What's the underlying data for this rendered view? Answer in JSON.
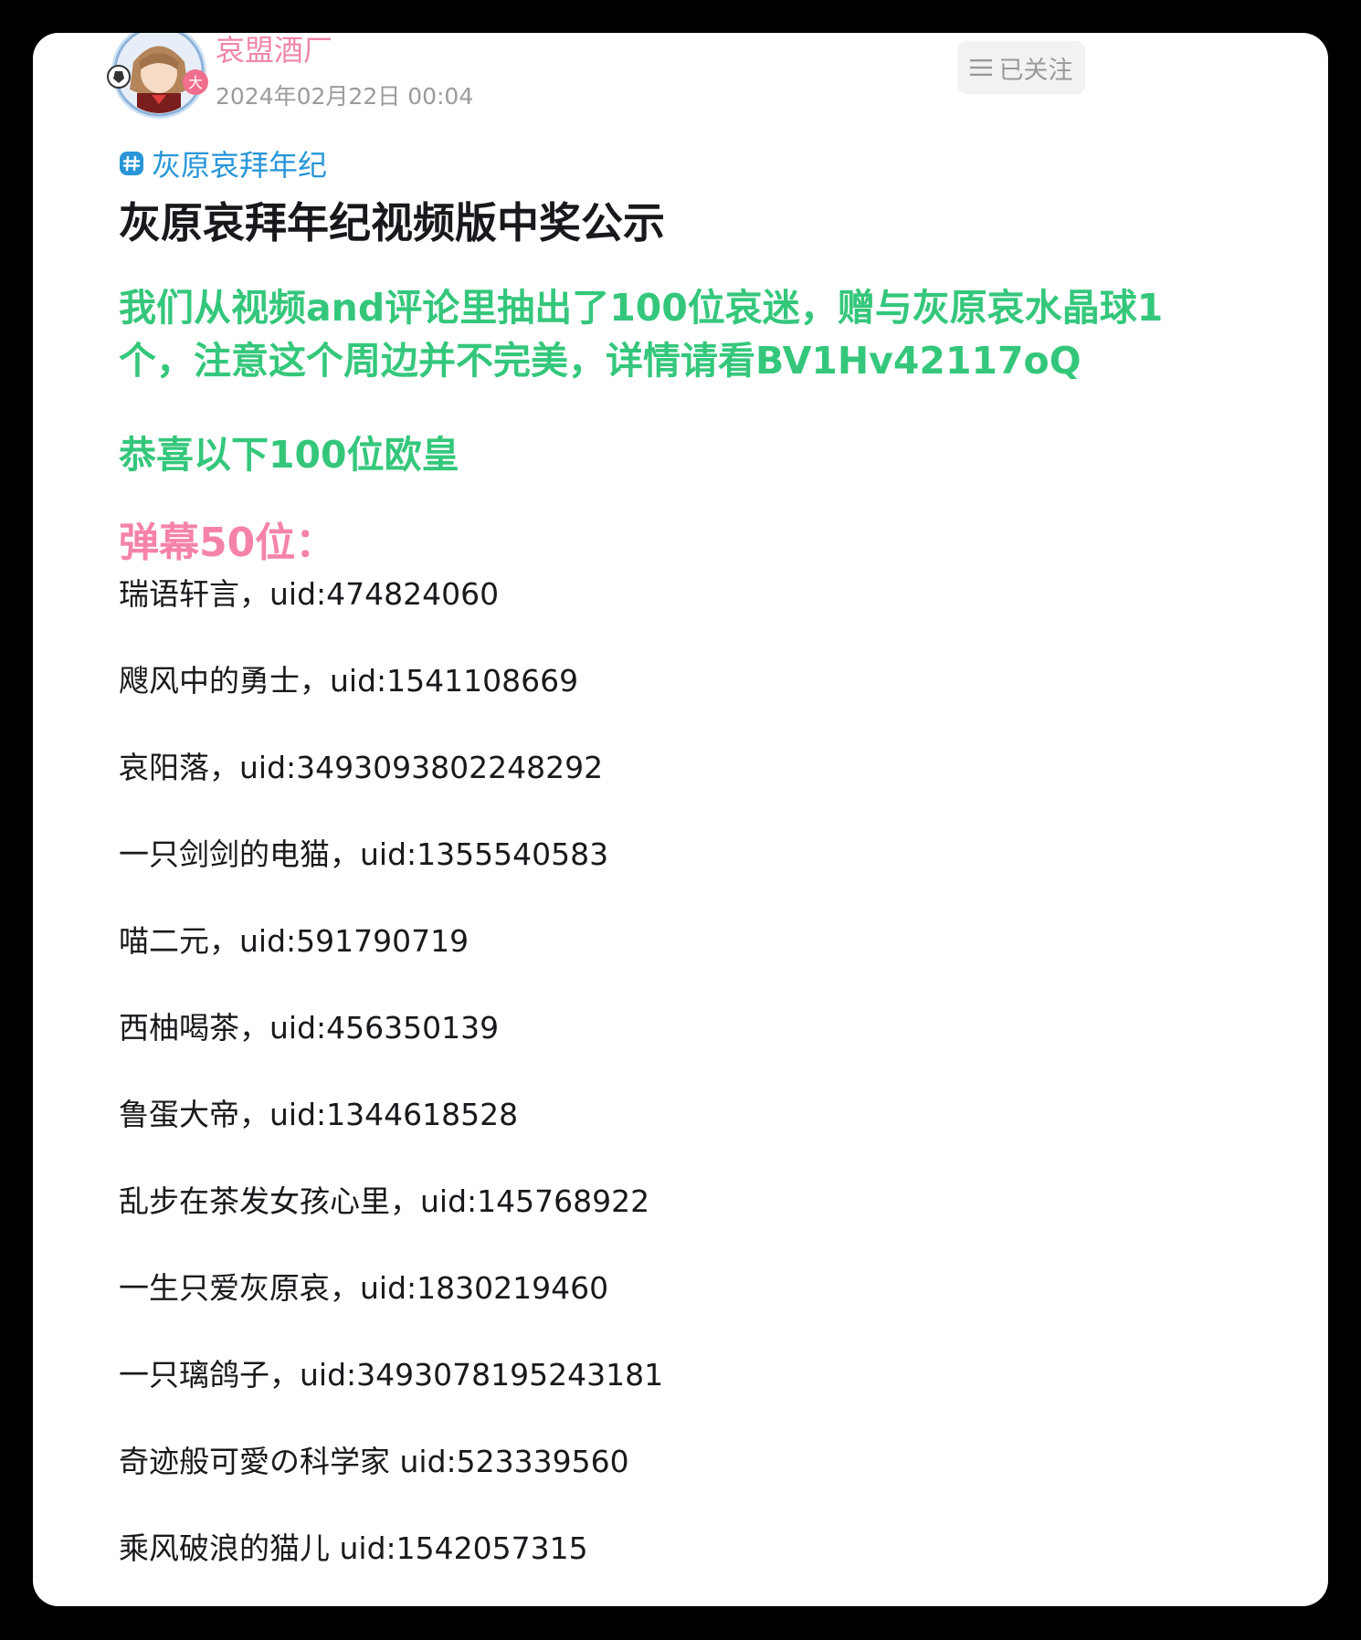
{
  "author": {
    "name": "哀盟酒厂",
    "time": "2024年02月22日 00:04",
    "avatar_badge": "大"
  },
  "follow_button": {
    "label": "已关注",
    "icon": "menu-icon"
  },
  "topic": {
    "label": "灰原哀拜年纪",
    "icon": "hashtag-icon"
  },
  "title": "灰原哀拜年纪视频版中奖公示",
  "intro": "我们从视频and评论里抽出了100位哀迷，赠与灰原哀水晶球1个，注意这个周边并不完美，详情请看BV1Hv42117oQ",
  "congrats": "恭喜以下100位欧皇",
  "section_title": "弹幕50位：",
  "winners": [
    "瑞语轩言，uid:474824060",
    "飕风中的勇士，uid:1541108669",
    "哀阳落，uid:3493093802248292",
    "一只剑剑的电猫，uid:1355540583",
    "喵二元，uid:591790719",
    "西柚喝茶，uid:456350139",
    "鲁蛋大帝，uid:1344618528",
    "乱步在茶发女孩心里，uid:145768922",
    "一生只爱灰原哀，uid:1830219460",
    "一只璃鸽子，uid:3493078195243181",
    "奇迹般可愛の科学家 uid:523339560",
    "乘风破浪的猫儿 uid:1542057315"
  ],
  "colors": {
    "author_name": "#f087a8",
    "topic": "#2896d8",
    "intro": "#34c77b",
    "section_title": "#f583a8",
    "text": "#18191c",
    "muted": "#9b9b9b"
  }
}
